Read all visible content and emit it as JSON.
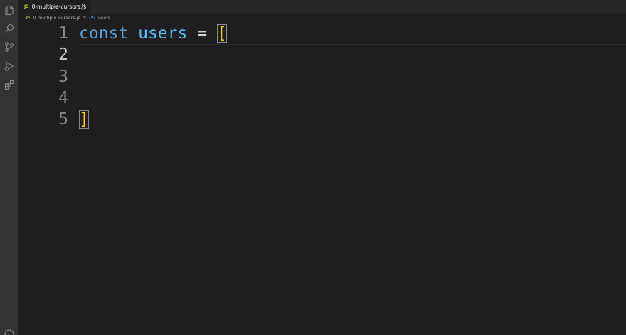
{
  "tab": {
    "icon_label": "JS",
    "label": "0-multiple-cursors.js",
    "close_glyph": "×"
  },
  "breadcrumb": {
    "file_icon_label": "JS",
    "file": "0-multiple-cursors.js",
    "separator": ">",
    "symbol_icon_label": "{ø}",
    "symbol": "users"
  },
  "activity_bar": {
    "icons": [
      "files-icon",
      "search-icon",
      "source-control-icon",
      "run-debug-icon",
      "extensions-icon"
    ]
  },
  "editor": {
    "lines": [
      {
        "number": "1",
        "keyword": "const",
        "variable": "users",
        "operator": "=",
        "bracket": "["
      },
      {
        "number": "2"
      },
      {
        "number": "3"
      },
      {
        "number": "4"
      },
      {
        "number": "5",
        "bracket": "]"
      }
    ],
    "active_line": 2
  },
  "colors": {
    "editor_bg": "#1e1e1e",
    "activity_bar_bg": "#333333",
    "keyword": "#569cd6",
    "variable": "#4fc1ff",
    "bracket": "#ffd700",
    "line_number": "#858585"
  }
}
